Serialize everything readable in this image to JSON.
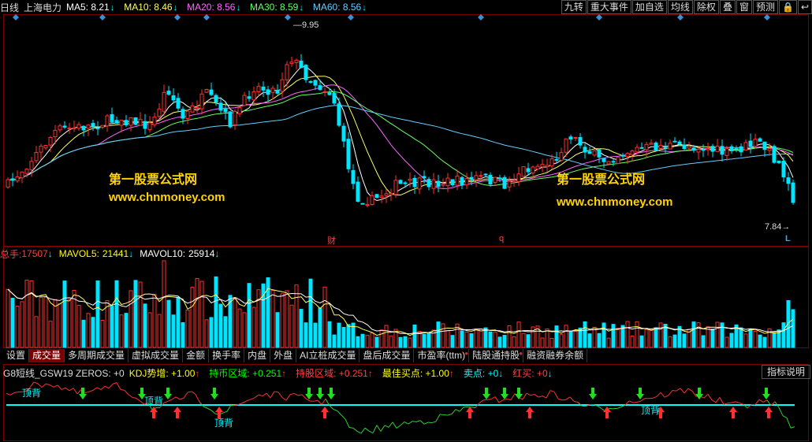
{
  "header": {
    "period": "日线",
    "stock_name": "上海电力",
    "ma": [
      {
        "label": "MA5:",
        "value": "8.21",
        "color": "#ffffff"
      },
      {
        "label": "MA10:",
        "value": "8.46",
        "color": "#ffff66"
      },
      {
        "label": "MA20:",
        "value": "8.56",
        "color": "#ff66ff"
      },
      {
        "label": "MA30:",
        "value": "8.59",
        "color": "#66ff66"
      },
      {
        "label": "MA60:",
        "value": "8.56",
        "color": "#66ccff"
      }
    ],
    "arrow_glyph": "↓"
  },
  "toolbar": [
    "九转",
    "重大事件",
    "加自选",
    "均线",
    "除权",
    "叠",
    "窗",
    "预测",
    "🔒",
    "↩"
  ],
  "price_chart": {
    "high_label": "9.95",
    "low_label": "7.84",
    "markers": [
      "财",
      "q",
      "L"
    ],
    "watermarks": [
      {
        "title": "第一股票公式网",
        "url": "www.chnmoney.com"
      },
      {
        "title": "第一股票公式网",
        "url": "www.chnmoney.com"
      }
    ]
  },
  "volume_header": {
    "total_label": "总手:",
    "total_value": "17507",
    "mavol5_label": "MAVOL5:",
    "mavol5_value": "21441",
    "mavol10_label": "MAVOL10:",
    "mavol10_value": "25914",
    "arrow_glyph": "↓"
  },
  "tabs": [
    {
      "label": "设置",
      "active": false,
      "dot": false
    },
    {
      "label": "成交量",
      "active": true,
      "dot": false
    },
    {
      "label": "多周期成交量",
      "active": false,
      "dot": false
    },
    {
      "label": "虚拟成交量",
      "active": false,
      "dot": false
    },
    {
      "label": "金额",
      "active": false,
      "dot": false
    },
    {
      "label": "换手率",
      "active": false,
      "dot": false
    },
    {
      "label": "内盘",
      "active": false,
      "dot": false
    },
    {
      "label": "外盘",
      "active": false,
      "dot": false
    },
    {
      "label": "AI立桩成交量",
      "active": false,
      "dot": false
    },
    {
      "label": "盘后成交量",
      "active": false,
      "dot": false
    },
    {
      "label": "市盈率(ttm)",
      "active": false,
      "dot": true
    },
    {
      "label": "陆股通持股",
      "active": false,
      "dot": true
    },
    {
      "label": "融资融券余额",
      "active": false,
      "dot": false
    }
  ],
  "indicator": {
    "items": [
      {
        "text": "G8短线_GSW19 ZEROS: +0",
        "color": "#dddddd"
      },
      {
        "text": "KDJ势增: +1.00",
        "color": "#ffff00",
        "arrow": "↑",
        "arrow_color": "#ff4040"
      },
      {
        "text": "持币区域: +0.251",
        "color": "#00ff00",
        "arrow": "↑",
        "arrow_color": "#ff4040"
      },
      {
        "text": "持股区域: +0.251",
        "color": "#ff4040",
        "arrow": "↑",
        "arrow_color": "#ff4040"
      },
      {
        "text": "最佳买点: +1.00",
        "color": "#ffff00",
        "arrow": "↑",
        "arrow_color": "#ff4040"
      },
      {
        "text": "卖点: +0",
        "color": "#00ffff",
        "arrow": "↓",
        "arrow_color": "#00ffff"
      },
      {
        "text": "红买: +0",
        "color": "#ff4040",
        "arrow": "↓",
        "arrow_color": "#00ffff"
      }
    ],
    "button": "指标说明",
    "labels": [
      "顶背",
      "顶背",
      "顶背",
      "顶背"
    ]
  }
}
